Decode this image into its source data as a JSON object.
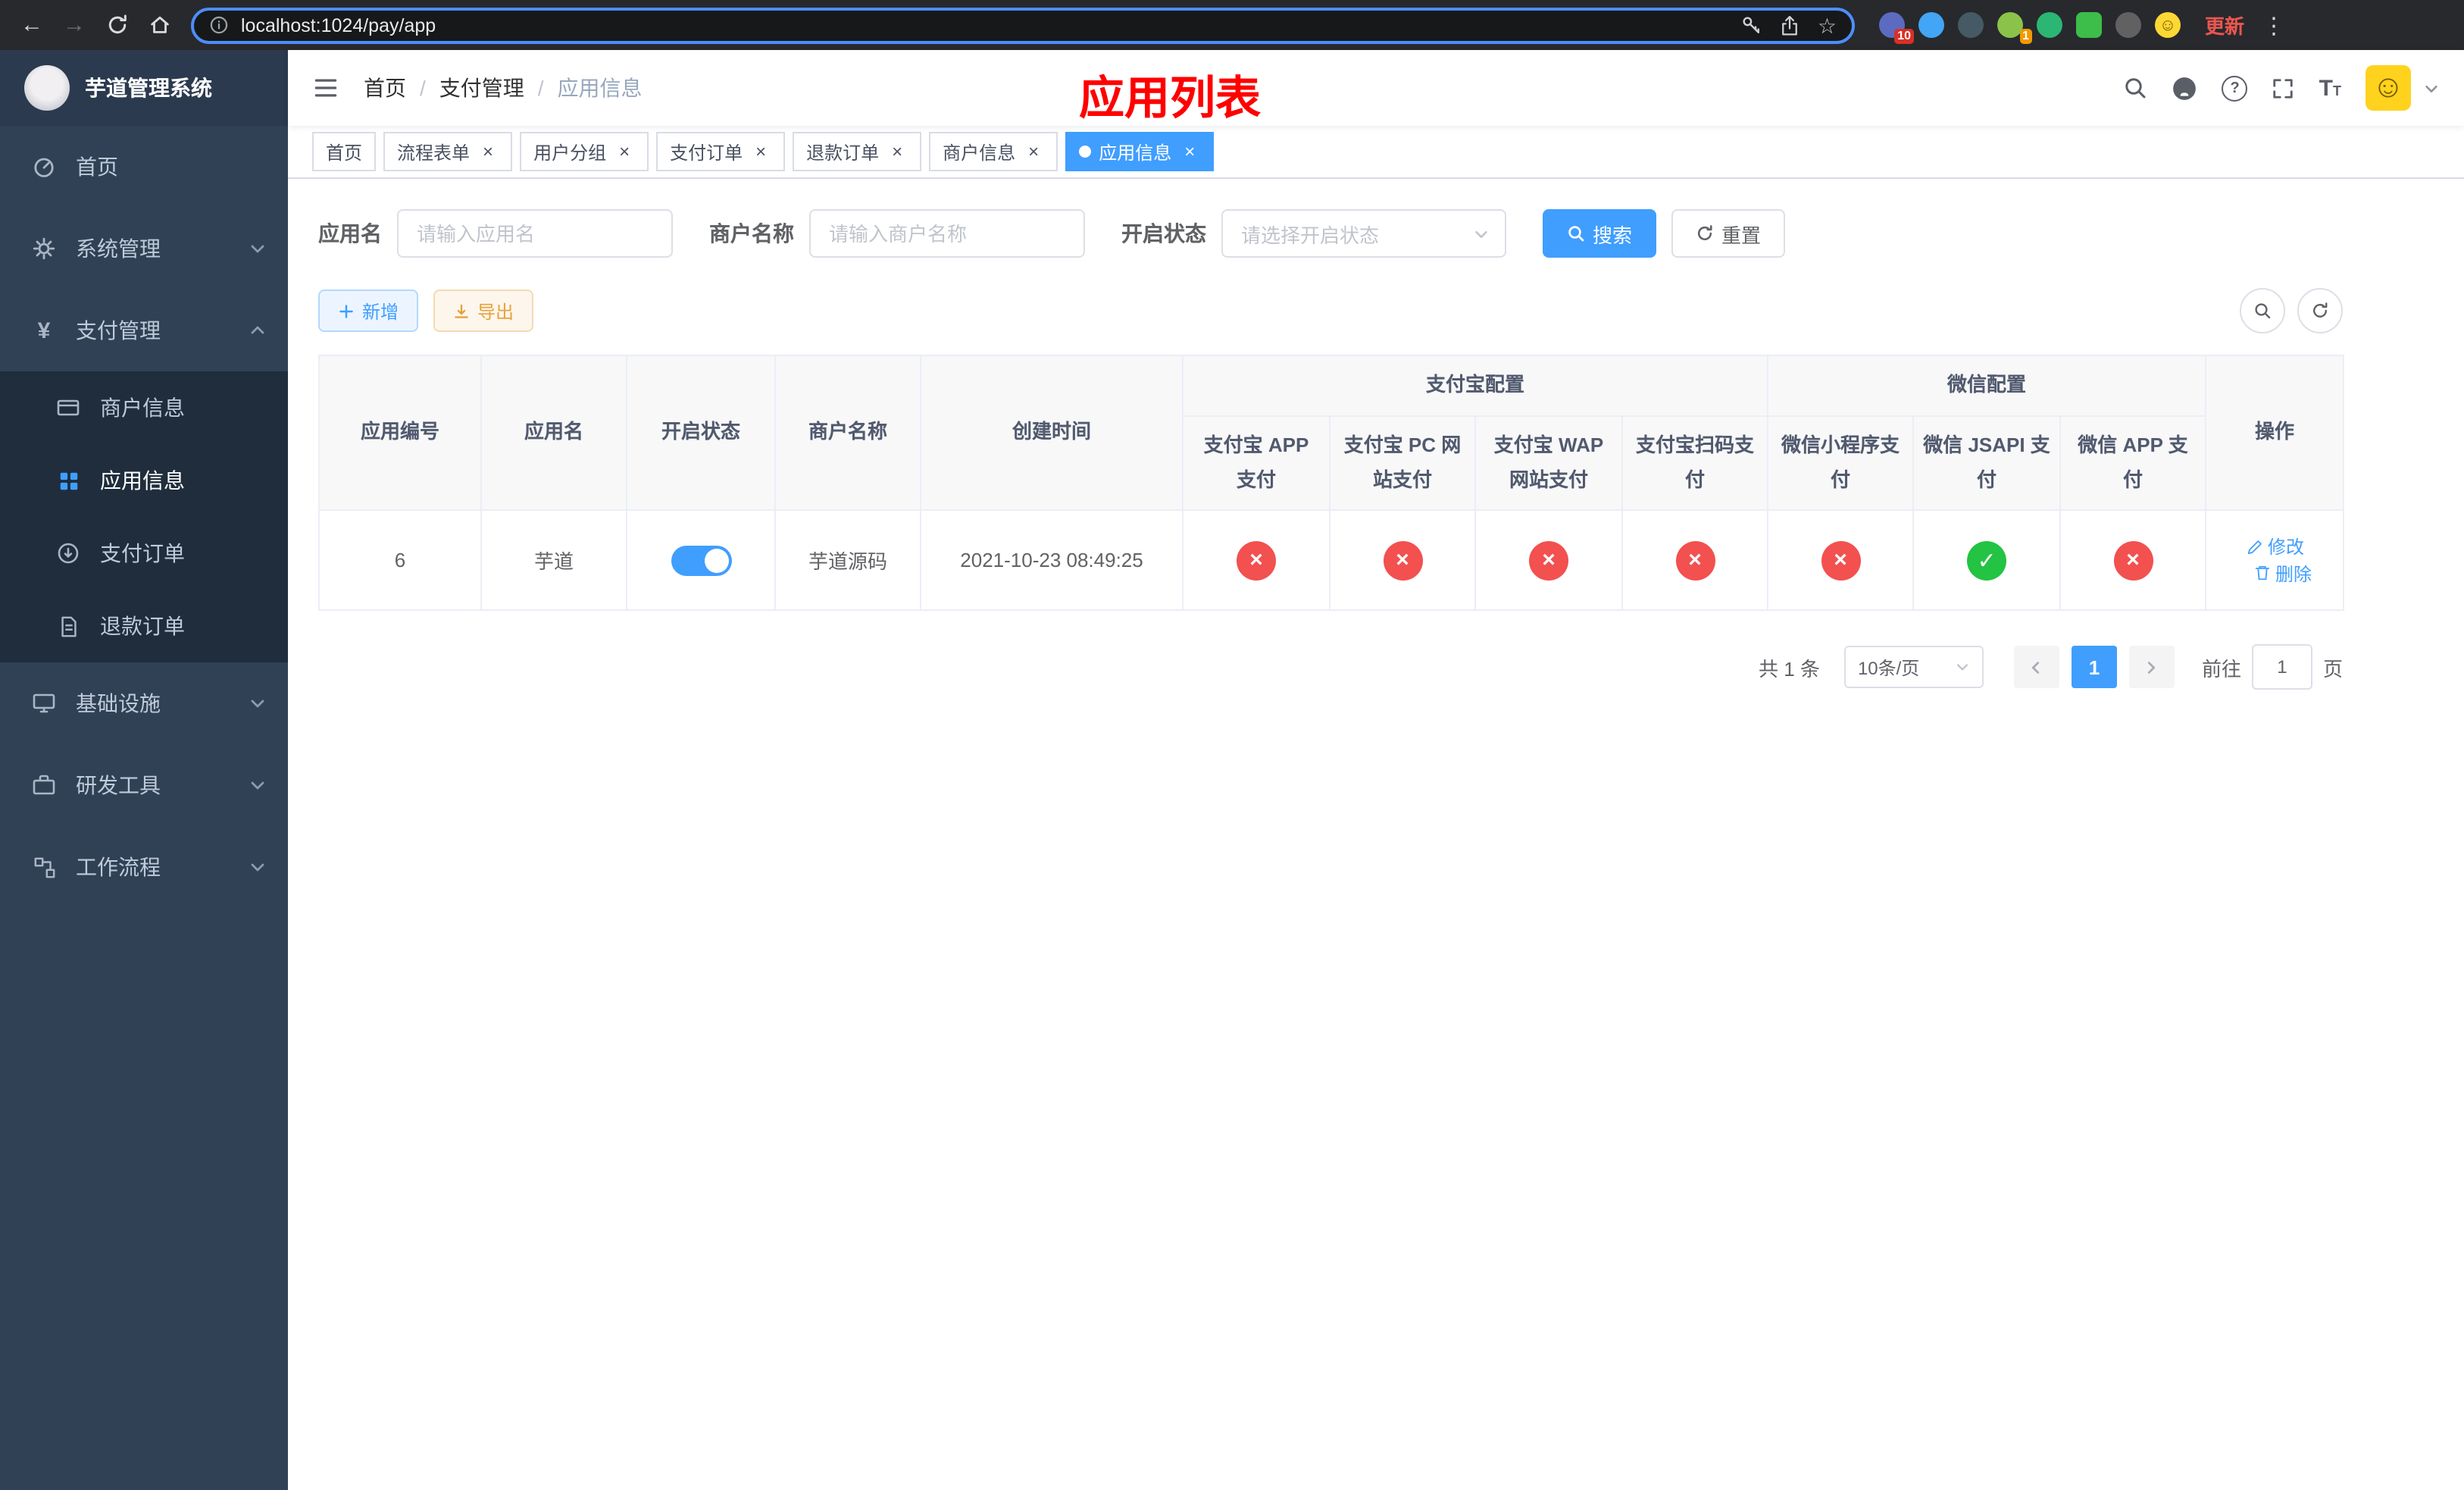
{
  "colors": {
    "accent": "#409eff",
    "success": "#23c343",
    "danger": "#f35050",
    "warning": "#e6a23c",
    "title_red": "#ff0000",
    "sidebar_bg": "#304156",
    "submenu_bg": "#1f2d3d"
  },
  "glyphs": {
    "back": "←",
    "forward": "→",
    "star": "☆",
    "menu_dots": "⋮",
    "close": "×",
    "question": "?",
    "yen": "¥",
    "smiley": "☺",
    "text_size_big": "T",
    "text_size_small": "T"
  },
  "browser": {
    "url": "localhost:1024/pay/app",
    "update_label": "更新",
    "extension_badge_1": "10",
    "extension_badge_2": "1"
  },
  "sidebar": {
    "title": "芋道管理系统",
    "items": [
      {
        "label": "首页"
      },
      {
        "label": "系统管理"
      },
      {
        "label": "支付管理",
        "children": [
          {
            "label": "商户信息"
          },
          {
            "label": "应用信息",
            "active": true
          },
          {
            "label": "支付订单"
          },
          {
            "label": "退款订单"
          }
        ]
      },
      {
        "label": "基础设施"
      },
      {
        "label": "研发工具"
      },
      {
        "label": "工作流程"
      }
    ]
  },
  "header": {
    "breadcrumb": [
      "首页",
      "支付管理",
      "应用信息"
    ],
    "separator": "/",
    "page_title": "应用列表"
  },
  "tabs": [
    {
      "label": "首页"
    },
    {
      "label": "流程表单"
    },
    {
      "label": "用户分组"
    },
    {
      "label": "支付订单"
    },
    {
      "label": "退款订单"
    },
    {
      "label": "商户信息"
    },
    {
      "label": "应用信息",
      "active": true
    }
  ],
  "filters": {
    "app_name_label": "应用名",
    "app_name_placeholder": "请输入应用名",
    "merchant_label": "商户名称",
    "merchant_placeholder": "请输入商户名称",
    "status_label": "开启状态",
    "status_placeholder": "请选择开启状态",
    "search_label": "搜索",
    "reset_label": "重置"
  },
  "toolbar": {
    "add_label": "新增",
    "export_label": "导出"
  },
  "table": {
    "groups": {
      "alipay": "支付宝配置",
      "wechat": "微信配置"
    },
    "columns": {
      "id": "应用编号",
      "name": "应用名",
      "status": "开启状态",
      "merchant": "商户名称",
      "created": "创建时间",
      "alipay_app": "支付宝 APP 支付",
      "alipay_pc": "支付宝 PC 网站支付",
      "alipay_wap": "支付宝 WAP 网站支付",
      "alipay_qr": "支付宝扫码支付",
      "wx_lite": "微信小程序支付",
      "wx_jsapi": "微信 JSAPI 支付",
      "wx_app": "微信 APP 支付",
      "actions": "操作"
    },
    "row": {
      "id": "6",
      "name": "芋道",
      "enabled": true,
      "merchant": "芋道源码",
      "created": "2021-10-23 08:49:25",
      "alipay_app": false,
      "alipay_pc": false,
      "alipay_wap": false,
      "alipay_qr": false,
      "wx_lite": false,
      "wx_jsapi": true,
      "wx_app": false,
      "edit_label": "修改",
      "delete_label": "删除"
    }
  },
  "pagination": {
    "total_text": "共 1 条",
    "page_size_text": "10条/页",
    "current_page": "1",
    "goto_prefix": "前往",
    "goto_value": "1",
    "goto_suffix": "页"
  }
}
